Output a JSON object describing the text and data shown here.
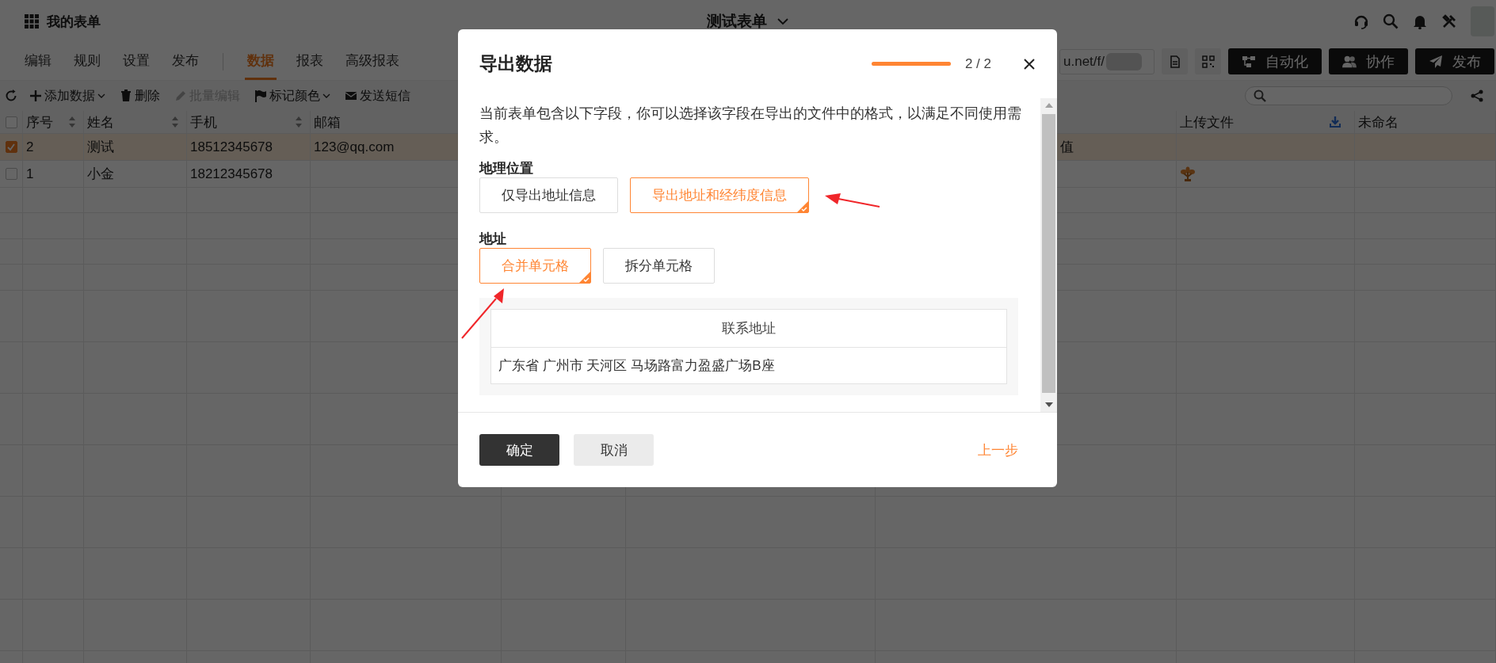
{
  "app": {
    "title": "我的表单",
    "form_title": "测试表单"
  },
  "nav_tabs": [
    {
      "label": "编辑",
      "selected": false
    },
    {
      "label": "规则",
      "selected": false
    },
    {
      "label": "设置",
      "selected": false
    },
    {
      "label": "发布",
      "selected": false
    },
    {
      "label": "数据",
      "selected": true
    },
    {
      "label": "报表",
      "selected": false
    },
    {
      "label": "高级报表",
      "selected": false
    }
  ],
  "url_field": {
    "value": "u.net/f/"
  },
  "action_buttons": [
    {
      "label": "自动化",
      "kind": "automation"
    },
    {
      "label": "协作",
      "kind": "collaborate"
    },
    {
      "label": "发布",
      "kind": "publish"
    }
  ],
  "toolbar": [
    {
      "label": "添加数据",
      "kind": "add",
      "dropdown": true,
      "disabled": false
    },
    {
      "label": "删除",
      "kind": "delete",
      "dropdown": false,
      "disabled": false
    },
    {
      "label": "批量编辑",
      "kind": "edit",
      "dropdown": false,
      "disabled": true
    },
    {
      "label": "标记颜色",
      "kind": "mark",
      "dropdown": true,
      "disabled": false
    },
    {
      "label": "发送短信",
      "kind": "sms",
      "dropdown": false,
      "disabled": false
    }
  ],
  "table": {
    "select_all": {
      "checked": false
    },
    "columns": [
      {
        "label": "序号",
        "sortable": true
      },
      {
        "label": "姓名",
        "sortable": true
      },
      {
        "label": "手机",
        "sortable": true
      },
      {
        "label": "邮箱"
      },
      {
        "label": "上传文件",
        "sortable": false,
        "download": true
      },
      {
        "label": "未命名",
        "sortable": false
      }
    ],
    "rows": [
      {
        "selected": true,
        "attachment": false,
        "cells": [
          "2",
          "测试",
          "18512345678",
          "123@qq.com",
          null,
          null,
          "值",
          null,
          null
        ]
      },
      {
        "selected": false,
        "attachment": true,
        "cells": [
          "1",
          "小金",
          "18212345678",
          null,
          null,
          null,
          null,
          null,
          null
        ]
      }
    ]
  },
  "dialog": {
    "title": "导出数据",
    "progress": {
      "level": 1
    },
    "step": "2 / 2",
    "description": "当前表单包含以下字段，你可以选择该字段在导出的文件中的格式，以满足不同使用需求。",
    "sections": [
      {
        "label": "地理位置",
        "options": [
          {
            "label": "仅导出地址信息",
            "selected": false
          },
          {
            "label": "导出地址和经纬度信息",
            "selected": true
          }
        ]
      },
      {
        "label": "地址",
        "options": [
          {
            "label": "合并单元格",
            "selected": true
          },
          {
            "label": "拆分单元格",
            "selected": false
          }
        ]
      }
    ],
    "preview": {
      "header": "联系地址",
      "value": "广东省 广州市 天河区 马场路富力盈盛广场B座"
    },
    "buttons": [
      {
        "label": "确定",
        "kind": "primary"
      },
      {
        "label": "取消",
        "kind": "secondary"
      },
      {
        "label": "上一步",
        "kind": "link"
      }
    ]
  }
}
